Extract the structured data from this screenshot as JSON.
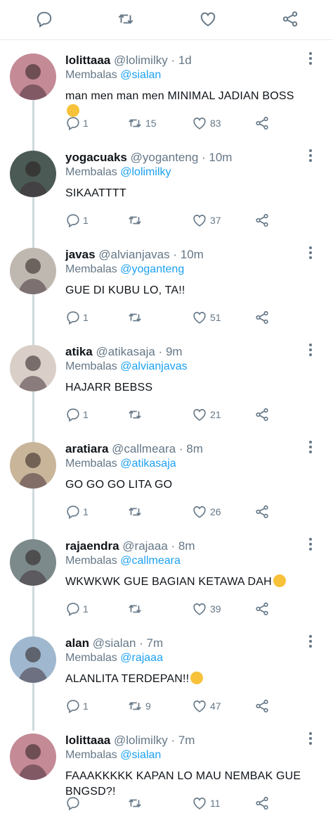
{
  "top_actions": [
    "reply-icon",
    "retweet-icon",
    "like-icon",
    "share-icon"
  ],
  "tweets": [
    {
      "name": "lolittaaa",
      "handle": "@lolimilky",
      "time": "1d",
      "reply_prefix": "Membalas",
      "reply_to": "@sialan",
      "text": "man men man men MINIMAL JADIAN BOSS",
      "emoji": "smirk",
      "replies": "1",
      "retweets": "15",
      "likes": "83",
      "avatar_color": "#c48a96"
    },
    {
      "name": "yogacuaks",
      "handle": "@yoganteng",
      "time": "10m",
      "reply_prefix": "Membalas",
      "reply_to": "@lolimilky",
      "text": "SIKAATTTT",
      "emoji": "",
      "replies": "1",
      "retweets": "",
      "likes": "37",
      "avatar_color": "#4b5a55"
    },
    {
      "name": "javas",
      "handle": "@alvianjavas",
      "time": "10m",
      "reply_prefix": "Membalas",
      "reply_to": "@yoganteng",
      "text": "GUE DI KUBU LO, TA!!",
      "emoji": "",
      "replies": "1",
      "retweets": "",
      "likes": "51",
      "avatar_color": "#bfb8b0"
    },
    {
      "name": "atika",
      "handle": "@atikasaja",
      "time": "9m",
      "reply_prefix": "Membalas",
      "reply_to": "@alvianjavas",
      "text": "HAJARR BEBSS",
      "emoji": "",
      "replies": "1",
      "retweets": "",
      "likes": "21",
      "avatar_color": "#d9cfc8"
    },
    {
      "name": "aratiara",
      "handle": "@callmeara",
      "time": "8m",
      "reply_prefix": "Membalas",
      "reply_to": "@atikasaja",
      "text": "GO GO GO LITA GO",
      "emoji": "",
      "replies": "1",
      "retweets": "",
      "likes": "26",
      "avatar_color": "#c9b59a"
    },
    {
      "name": "rajaendra",
      "handle": "@rajaaa",
      "time": "8m",
      "reply_prefix": "Membalas",
      "reply_to": "@callmeara",
      "text": "WKWKWK GUE BAGIAN KETAWA DAH",
      "emoji": "laugh",
      "replies": "1",
      "retweets": "",
      "likes": "39",
      "avatar_color": "#7d8a8c"
    },
    {
      "name": "alan",
      "handle": "@sialan",
      "time": "7m",
      "reply_prefix": "Membalas",
      "reply_to": "@rajaaa",
      "text": "ALANLITA TERDEPAN!!",
      "emoji": "heart-eyes",
      "replies": "1",
      "retweets": "9",
      "likes": "47",
      "avatar_color": "#9fb8cf"
    },
    {
      "name": "lolittaaa",
      "handle": "@lolimilky",
      "time": "7m",
      "reply_prefix": "Membalas",
      "reply_to": "@sialan",
      "text": "FAAAKKKKK KAPAN LO MAU NEMBAK GUE BNGSD?!",
      "emoji": "",
      "replies": "",
      "retweets": "",
      "likes": "11",
      "avatar_color": "#c48a96"
    }
  ]
}
